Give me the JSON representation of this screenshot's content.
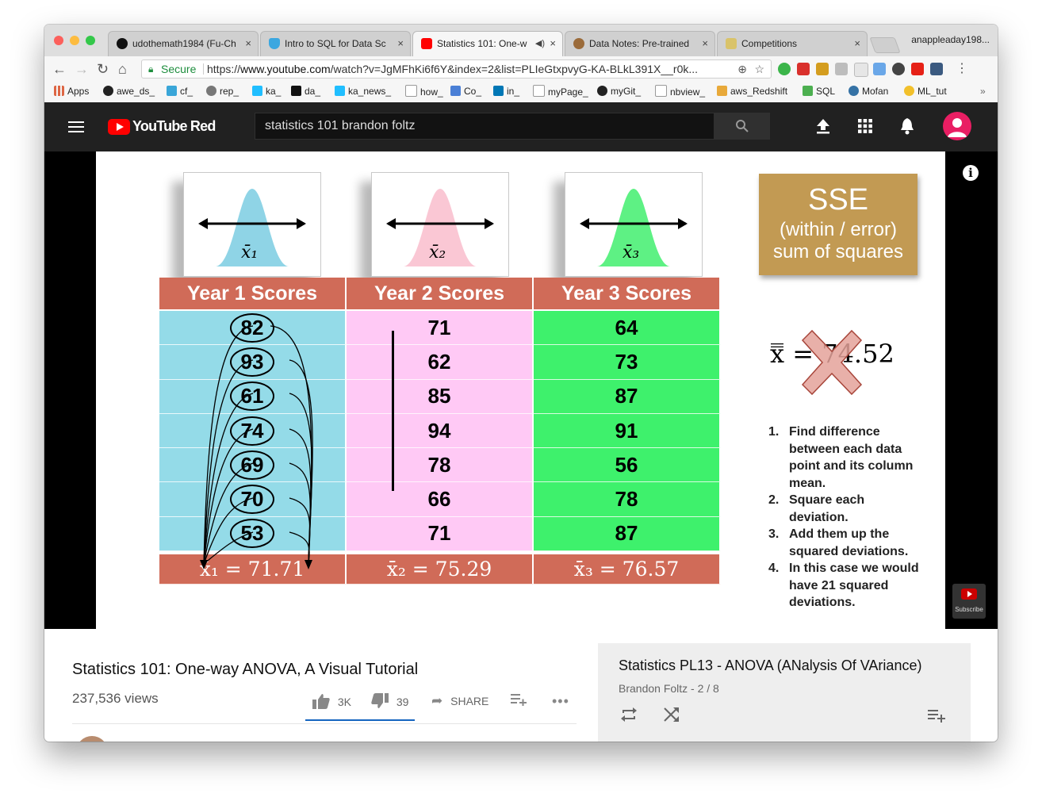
{
  "browser": {
    "tabs": [
      {
        "title": "udothemath1984 (Fu-Ch",
        "icon": "github-icon"
      },
      {
        "title": "Intro to SQL for Data Sc",
        "icon": "shield-icon"
      },
      {
        "title": "Statistics 101: One-w",
        "icon": "youtube-icon",
        "active": true
      },
      {
        "title": "Data Notes: Pre-trained",
        "icon": "cookie-icon"
      },
      {
        "title": "Competitions",
        "icon": "kaggle-icon"
      }
    ],
    "tab_close": "×",
    "profile": "anappleaday198...",
    "secure_label": "Secure",
    "url_scheme": "https://",
    "url_host": "www.youtube.com",
    "url_rest": "/watch?v=JgMFhKi6f6Y&index=2&list=PLIeGtxpvyG-KA-BLkL391X__r0k...",
    "bookmarks": [
      "Apps",
      "awe_ds_",
      "cf_",
      "rep_",
      "ka_",
      "da_",
      "ka_news_",
      "how_",
      "Co_",
      "in_",
      "myPage_",
      "myGit_",
      "nbview_",
      "aws_Redshift",
      "SQL",
      "Mofan",
      "ML_tut"
    ],
    "bookmarks_more": "»"
  },
  "youtube": {
    "logo_text": "YouTube Red",
    "search_value": "statistics 101 brandon foltz"
  },
  "slide": {
    "sse_title": "SSE",
    "sse_line2": "(within / error)",
    "sse_line3": "sum of squares",
    "card_labels": [
      "x̄₁",
      "x̄₂",
      "x̄₃"
    ],
    "columns": [
      "Year 1 Scores",
      "Year 2 Scores",
      "Year 3 Scores"
    ],
    "rows": [
      [
        "82",
        "71",
        "64"
      ],
      [
        "93",
        "62",
        "73"
      ],
      [
        "61",
        "85",
        "87"
      ],
      [
        "74",
        "94",
        "91"
      ],
      [
        "69",
        "78",
        "56"
      ],
      [
        "70",
        "66",
        "78"
      ],
      [
        "53",
        "71",
        "87"
      ]
    ],
    "means": [
      "x̄₁ = 71.71",
      "x̄₂ = 75.29",
      "x̄₃ = 76.57"
    ],
    "grand_mean": "x̿ = 74.52",
    "steps": [
      {
        "num": "1.",
        "text": "Find difference between each data point and its column mean."
      },
      {
        "num": "2.",
        "text": "Square each deviation."
      },
      {
        "num": "3.",
        "text": "Add them up the squared deviations."
      },
      {
        "num": "4.",
        "text": "In this case we would have 21 squared deviations."
      }
    ],
    "subscribe_label": "Subscribe",
    "info_glyph": "i"
  },
  "video": {
    "title": "Statistics 101: One-way ANOVA, A Visual Tutorial",
    "views": "237,536 views",
    "likes": "3K",
    "dislikes": "39",
    "share": "SHARE"
  },
  "playlist": {
    "title": "Statistics PL13 - ANOVA (ANalysis Of VAriance)",
    "subtitle": "Brandon Foltz - 2 / 8"
  },
  "colors": {
    "youtube_red": "#ff0000",
    "header_bg": "#212121",
    "table_header": "#d06b58",
    "col1": "#94dbe8",
    "col2": "#ffc9f5",
    "col3": "#3ef16c",
    "sse_box": "#c29a53"
  }
}
